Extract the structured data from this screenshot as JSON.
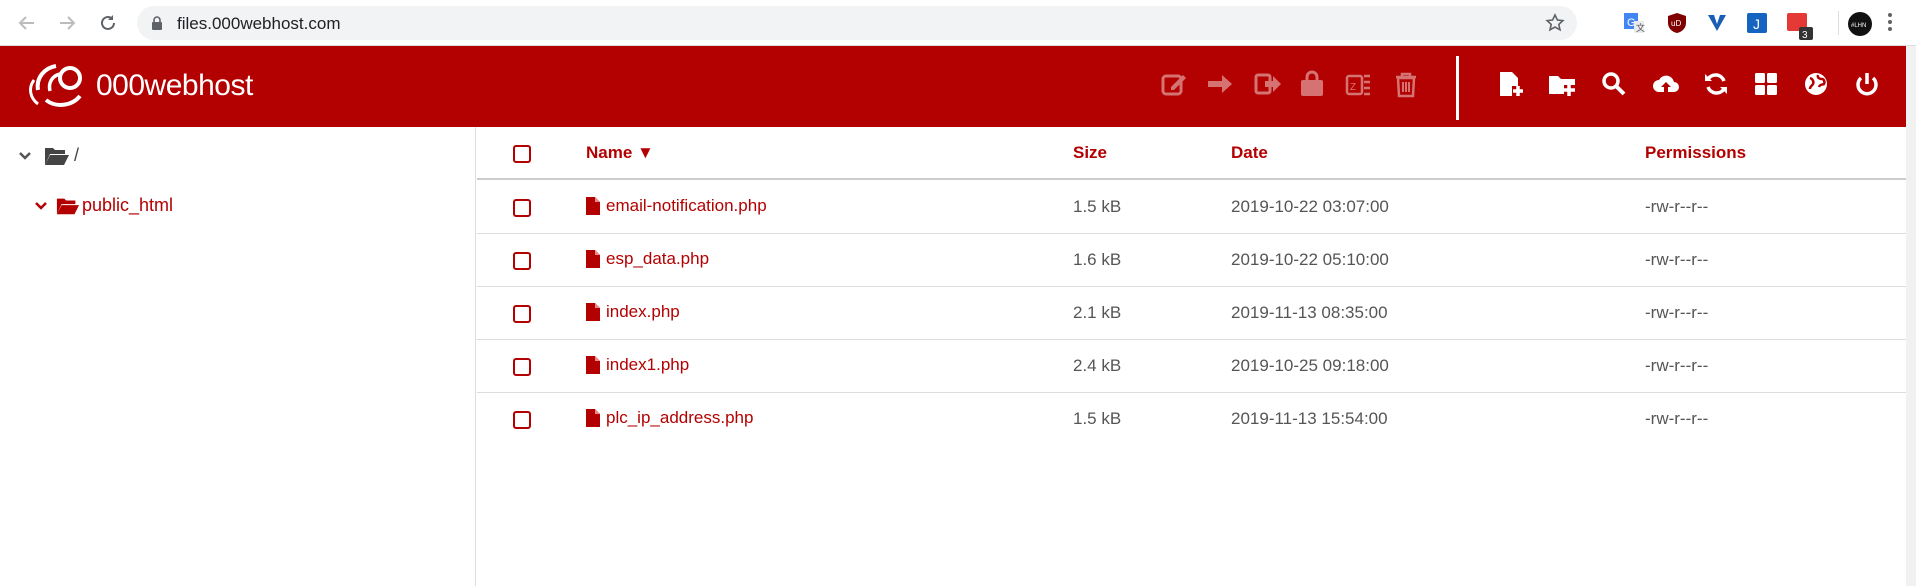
{
  "browser": {
    "url": "files.000webhost.com",
    "extension_badge": "3"
  },
  "app": {
    "brand": "000webhost",
    "colors": {
      "brand": "#b30000"
    }
  },
  "toolbar": {
    "left_icons": [
      "edit-icon",
      "move-icon",
      "rename-icon",
      "permissions-icon",
      "extract-icon",
      "delete-icon"
    ],
    "right_icons": [
      "new-file-icon",
      "new-folder-icon",
      "search-icon",
      "upload-icon",
      "refresh-icon",
      "grid-view-icon",
      "globe-icon",
      "power-icon"
    ]
  },
  "tree": {
    "root": "/",
    "children": [
      "public_html"
    ]
  },
  "table": {
    "headers": {
      "name": "Name ▼",
      "size": "Size",
      "date": "Date",
      "permissions": "Permissions"
    },
    "rows": [
      {
        "name": "email-notification.php",
        "size": "1.5 kB",
        "date": "2019-10-22 03:07:00",
        "permissions": "-rw-r--r--"
      },
      {
        "name": "esp_data.php",
        "size": "1.6 kB",
        "date": "2019-10-22 05:10:00",
        "permissions": "-rw-r--r--"
      },
      {
        "name": "index.php",
        "size": "2.1 kB",
        "date": "2019-11-13 08:35:00",
        "permissions": "-rw-r--r--"
      },
      {
        "name": "index1.php",
        "size": "2.4 kB",
        "date": "2019-10-25 09:18:00",
        "permissions": "-rw-r--r--"
      },
      {
        "name": "plc_ip_address.php",
        "size": "1.5 kB",
        "date": "2019-11-13 15:54:00",
        "permissions": "-rw-r--r--"
      }
    ]
  }
}
